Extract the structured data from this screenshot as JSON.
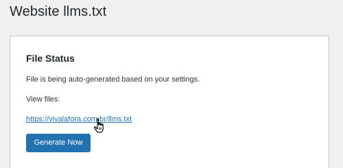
{
  "page": {
    "title": "Website llms.txt"
  },
  "file_status": {
    "heading": "File Status",
    "status_text": "File is being auto-generated based on your settings.",
    "view_label": "View files:",
    "file_link": "https://vivalafora.com.br/llms.txt",
    "generate_button": "Generate Now"
  },
  "cursor": {
    "icon": "hand-pointer-icon"
  },
  "colors": {
    "background": "#f0f0f1",
    "card": "#ffffff",
    "accent": "#2271b1",
    "text": "#1d2327"
  }
}
